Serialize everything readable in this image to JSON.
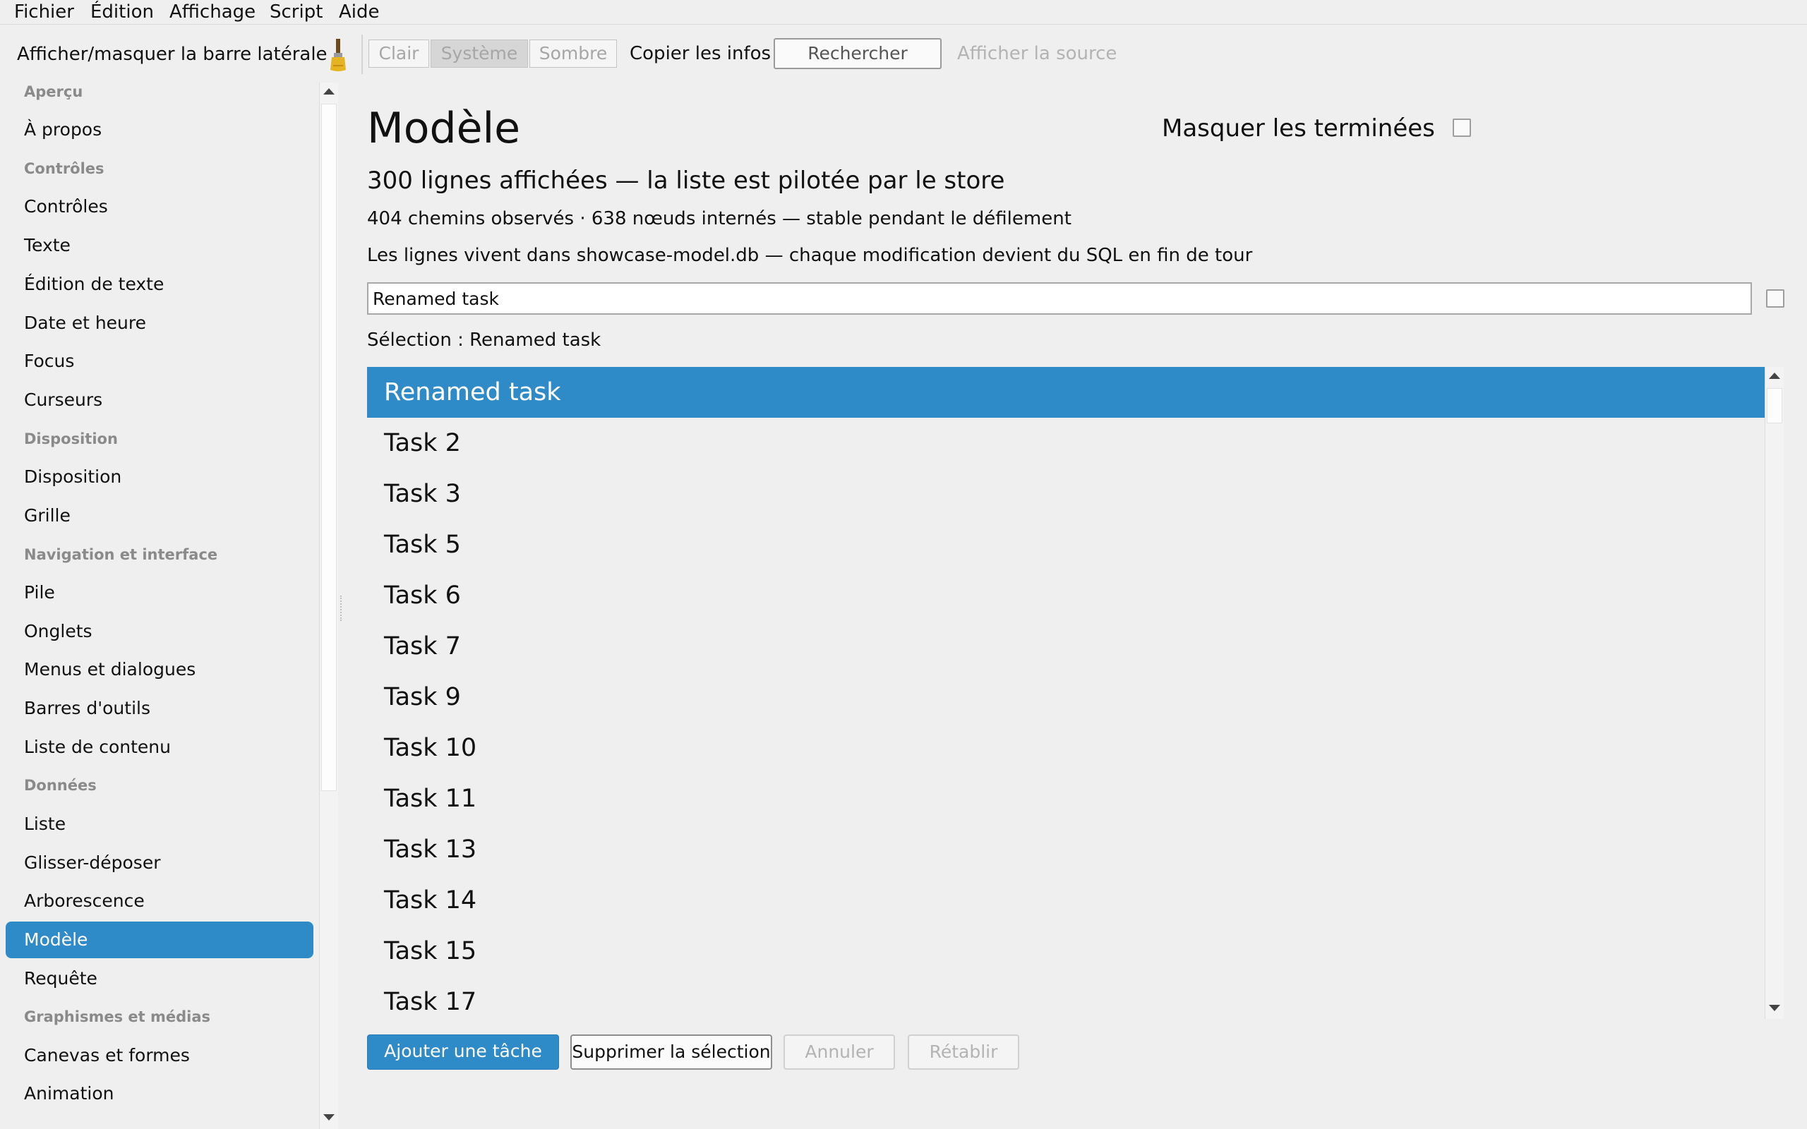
{
  "menu": [
    "Fichier",
    "Édition",
    "Affichage",
    "Script",
    "Aide"
  ],
  "toolbar": {
    "sidebar_toggle": "Afficher/masquer la barre latérale",
    "theme_options": [
      "Clair",
      "Système",
      "Sombre"
    ],
    "theme_selected": "Système",
    "copy_info": "Copier les infos",
    "search_placeholder": "Rechercher",
    "show_source": "Afficher la source"
  },
  "sidebar": {
    "entries": [
      {
        "type": "header",
        "label": "Aperçu"
      },
      {
        "type": "item",
        "label": "À propos"
      },
      {
        "type": "header",
        "label": "Contrôles"
      },
      {
        "type": "item",
        "label": "Contrôles"
      },
      {
        "type": "item",
        "label": "Texte"
      },
      {
        "type": "item",
        "label": "Édition de texte"
      },
      {
        "type": "item",
        "label": "Date et heure"
      },
      {
        "type": "item",
        "label": "Focus"
      },
      {
        "type": "item",
        "label": "Curseurs"
      },
      {
        "type": "header",
        "label": "Disposition"
      },
      {
        "type": "item",
        "label": "Disposition"
      },
      {
        "type": "item",
        "label": "Grille"
      },
      {
        "type": "header",
        "label": "Navigation et interface"
      },
      {
        "type": "item",
        "label": "Pile"
      },
      {
        "type": "item",
        "label": "Onglets"
      },
      {
        "type": "item",
        "label": "Menus et dialogues"
      },
      {
        "type": "item",
        "label": "Barres d'outils"
      },
      {
        "type": "item",
        "label": "Liste de contenu"
      },
      {
        "type": "header",
        "label": "Données"
      },
      {
        "type": "item",
        "label": "Liste"
      },
      {
        "type": "item",
        "label": "Glisser-déposer"
      },
      {
        "type": "item",
        "label": "Arborescence"
      },
      {
        "type": "item",
        "label": "Modèle",
        "selected": true
      },
      {
        "type": "item",
        "label": "Requête"
      },
      {
        "type": "header",
        "label": "Graphismes et médias"
      },
      {
        "type": "item",
        "label": "Canevas et formes"
      },
      {
        "type": "item",
        "label": "Animation"
      }
    ]
  },
  "main": {
    "title": "Modèle",
    "hide_done_label": "Masquer les terminées",
    "hide_done_checked": false,
    "subtitle": "300 lignes affichées — la liste est pilotée par le store",
    "stats": "404 chemins observés · 638 nœuds internés — stable pendant le défilement",
    "info": "Les lignes vivent dans showcase-model.db — chaque modification devient du SQL en fin de tour",
    "edit_value": "Renamed task",
    "edit_checked": false,
    "selection_text": "Sélection : Renamed task",
    "rows": [
      "Renamed task",
      "Task 2",
      "Task 3",
      "Task 5",
      "Task 6",
      "Task 7",
      "Task 9",
      "Task 10",
      "Task 11",
      "Task 13",
      "Task 14",
      "Task 15",
      "Task 17"
    ],
    "selected_row": 0,
    "buttons": {
      "add": "Ajouter une tâche",
      "delete": "Supprimer la sélection",
      "undo": "Annuler",
      "redo": "Rétablir"
    }
  },
  "colors": {
    "accent": "#2f8ac8",
    "background": "#efefef",
    "disabled_text": "#b3b3b3"
  }
}
